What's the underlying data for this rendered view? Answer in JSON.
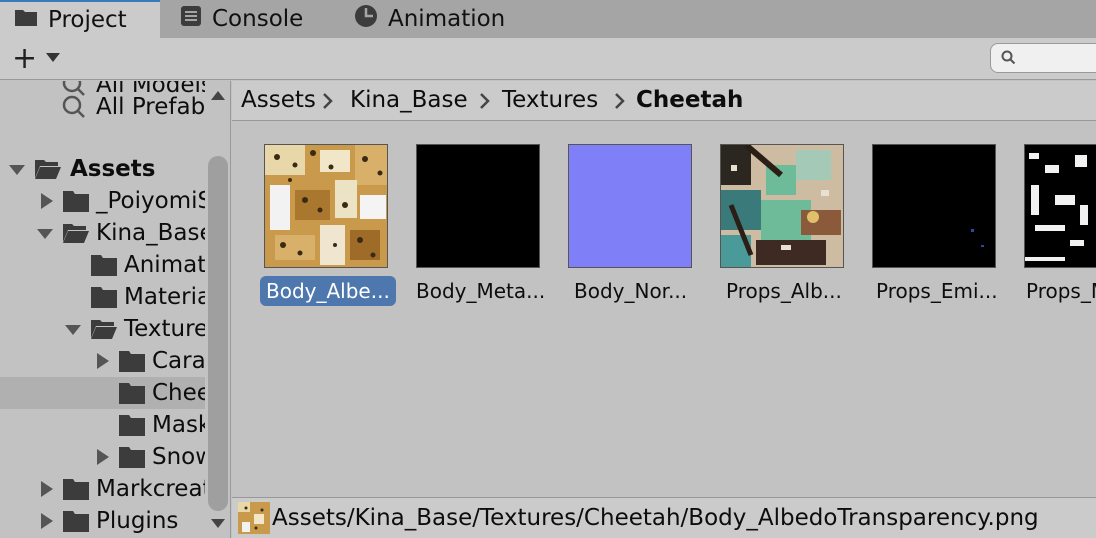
{
  "tabs": [
    {
      "label": "Project",
      "icon": "folder-icon",
      "active": true
    },
    {
      "label": "Console",
      "icon": "console-icon",
      "active": false
    },
    {
      "label": "Animation",
      "icon": "clock-icon",
      "active": false
    }
  ],
  "toolbar": {
    "add_label": "+",
    "search_value": ""
  },
  "tree": {
    "items": [
      {
        "label": "All Models",
        "type": "search",
        "indent": 1,
        "expanded": null
      },
      {
        "label": "All Prefabs",
        "type": "search",
        "indent": 1,
        "expanded": null
      },
      {
        "label": "Assets",
        "type": "folder",
        "indent": 0,
        "expanded": true,
        "bold": true
      },
      {
        "label": "_PoiyomiShaders",
        "type": "folder",
        "indent": 1,
        "expanded": false
      },
      {
        "label": "Kina_Base",
        "type": "folder",
        "indent": 1,
        "expanded": true
      },
      {
        "label": "Animations",
        "type": "folder",
        "indent": 2,
        "expanded": null
      },
      {
        "label": "Materials",
        "type": "folder",
        "indent": 2,
        "expanded": null
      },
      {
        "label": "Textures",
        "type": "folder",
        "indent": 2,
        "expanded": true
      },
      {
        "label": "Caracal",
        "type": "folder",
        "indent": 3,
        "expanded": false
      },
      {
        "label": "Cheetah",
        "type": "folder",
        "indent": 3,
        "expanded": null,
        "selected": true
      },
      {
        "label": "Mask",
        "type": "folder",
        "indent": 3,
        "expanded": null
      },
      {
        "label": "Snow",
        "type": "folder",
        "indent": 3,
        "expanded": false
      },
      {
        "label": "Markcreations",
        "type": "folder",
        "indent": 1,
        "expanded": false
      },
      {
        "label": "Plugins",
        "type": "folder",
        "indent": 1,
        "expanded": false
      }
    ]
  },
  "breadcrumb": [
    "Assets",
    "Kina_Base",
    "Textures",
    "Cheetah"
  ],
  "assets": [
    {
      "label": "Body_Albe...",
      "kind": "albedo",
      "selected": true
    },
    {
      "label": "Body_Meta...",
      "kind": "black",
      "selected": false
    },
    {
      "label": "Body_Nor...",
      "kind": "normal",
      "selected": false
    },
    {
      "label": "Props_Alb...",
      "kind": "props-albedo",
      "selected": false
    },
    {
      "label": "Props_Emi...",
      "kind": "emission",
      "selected": false
    },
    {
      "label": "Props_M",
      "kind": "mask",
      "selected": false
    }
  ],
  "status": {
    "path": "Assets/Kina_Base/Textures/Cheetah/Body_AlbedoTransparency.png"
  },
  "colors": {
    "selection": "#4d77ad",
    "tab_accent": "#3a79bb",
    "normal_map": "#7f7ff8"
  }
}
